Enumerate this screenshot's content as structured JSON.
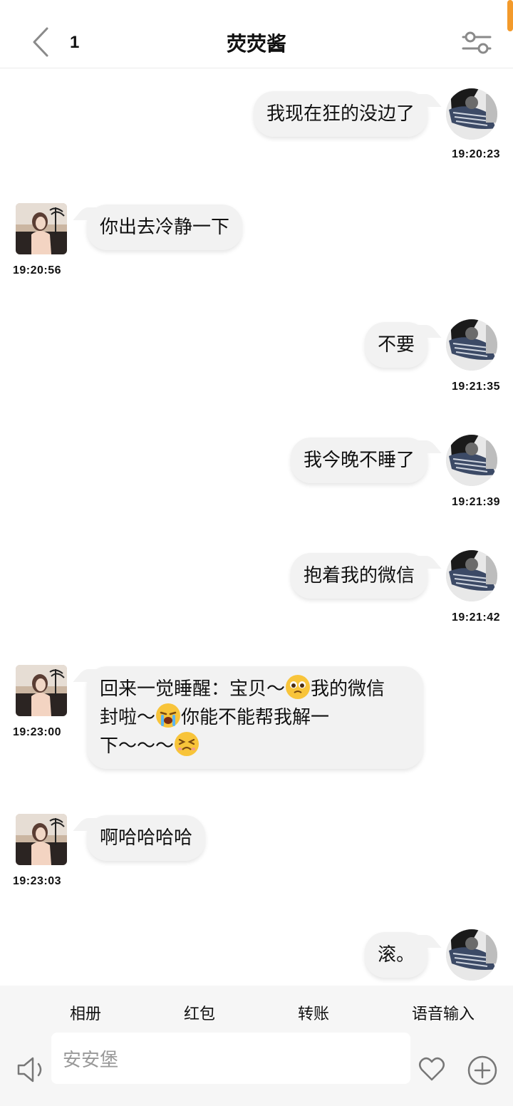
{
  "header": {
    "back_icon": "chevron-left-icon",
    "unread_count": "1",
    "title": "荧荧酱",
    "settings_icon": "sliders-icon"
  },
  "messages": [
    {
      "side": "self",
      "text": "我现在狂的没边了",
      "time": "19:20:23"
    },
    {
      "side": "other",
      "text": "你出去冷静一下",
      "time": "19:20:56"
    },
    {
      "side": "self",
      "text": "不要",
      "time": "19:21:35"
    },
    {
      "side": "self",
      "text": "我今晚不睡了",
      "time": "19:21:39"
    },
    {
      "side": "self",
      "text": "抱着我的微信",
      "time": "19:21:42"
    },
    {
      "side": "other",
      "lines": [
        "回来一觉睡醒：宝贝～",
        "我的微信",
        "封啦～",
        "你能不能帮我解一",
        "下～～～"
      ],
      "time": "19:23:00"
    },
    {
      "side": "other",
      "text": "啊哈哈哈哈",
      "time": "19:23:03"
    },
    {
      "side": "self",
      "text": "滚。"
    }
  ],
  "toolbar": {
    "album": "相册",
    "red_packet": "红包",
    "transfer": "转账",
    "voice_input": "语音输入"
  },
  "input": {
    "value": "安安堡",
    "voice_icon": "speaker-icon",
    "heart_icon": "heart-icon",
    "plus_icon": "plus-circle-icon"
  },
  "colors": {
    "bubble": "#f2f2f2",
    "scroll_indicator": "#f39a2b",
    "emoji": "#f8c43a"
  }
}
